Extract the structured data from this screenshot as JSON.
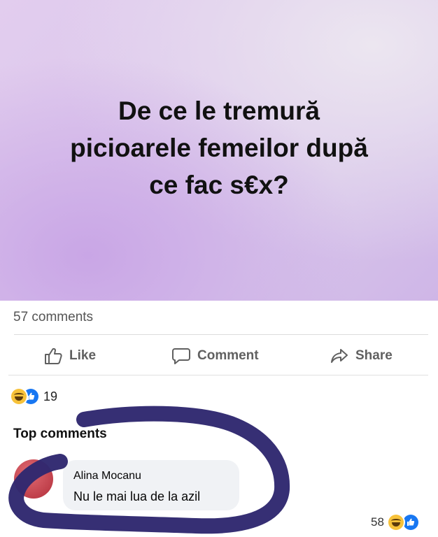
{
  "post": {
    "lines": [
      "De ce le tremură",
      "picioarele femeilor după",
      "ce fac s€x?"
    ],
    "background_color": "#dcc7ec"
  },
  "stats": {
    "comments_count": "57 comments"
  },
  "actions": {
    "like_label": "Like",
    "comment_label": "Comment",
    "share_label": "Share"
  },
  "reactions": {
    "icons": [
      "haha-icon",
      "like-icon"
    ],
    "count": "19"
  },
  "section": {
    "top_comments_label": "Top comments"
  },
  "comment": {
    "author": "Alina Mocanu",
    "text": "Nu le mai lua de la azil",
    "reaction_count": "58",
    "reaction_icons": [
      "haha-icon",
      "like-icon"
    ]
  },
  "colors": {
    "marker": "#2f2870",
    "like_blue": "#1877f2",
    "haha_yellow": "#f7c23a"
  }
}
